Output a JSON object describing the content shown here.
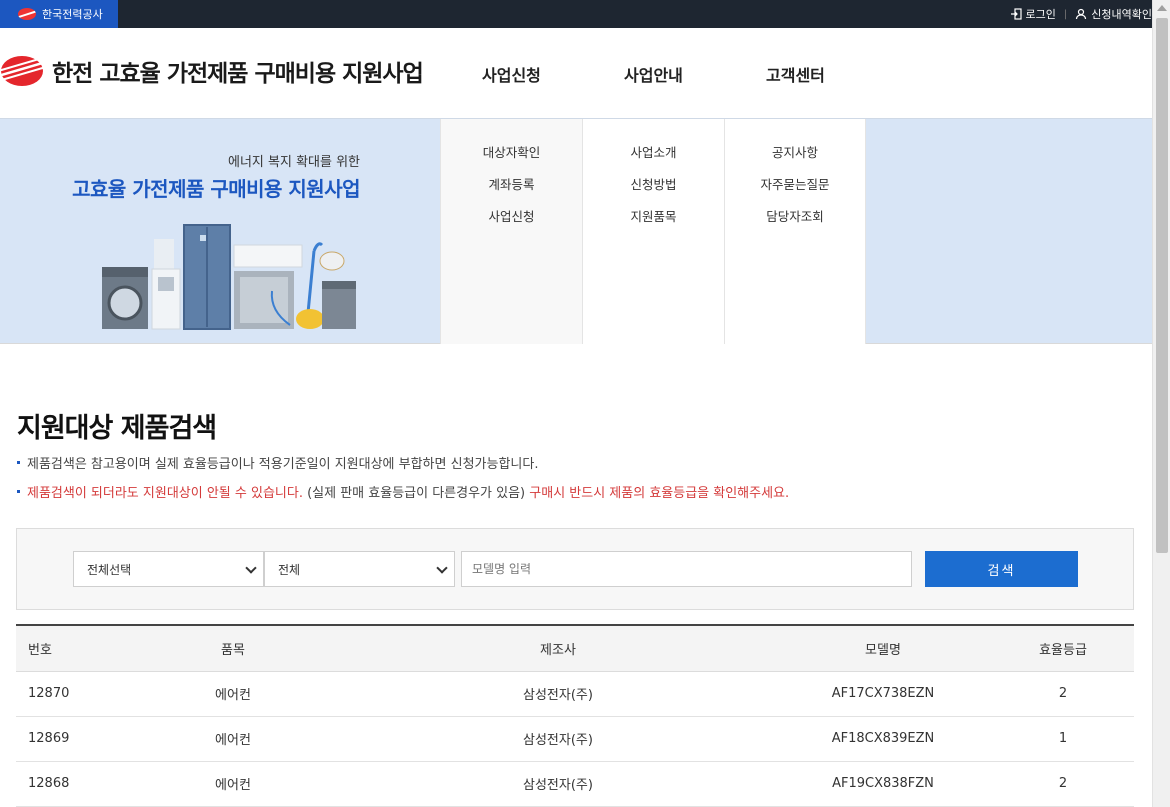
{
  "topbar": {
    "org_name": "한국전력공사",
    "login_label": "로그인",
    "check_label": "신청내역확인"
  },
  "header": {
    "title": "한전 고효율 가전제품 구매비용 지원사업",
    "nav": [
      {
        "label": "사업신청"
      },
      {
        "label": "사업안내"
      },
      {
        "label": "고객센터"
      }
    ]
  },
  "mega": {
    "promo_sub": "에너지 복지 확대를 위한",
    "promo_title": "고효율 가전제품 구매비용 지원사업",
    "columns": [
      {
        "items": [
          "대상자확인",
          "계좌등록",
          "사업신청"
        ]
      },
      {
        "items": [
          "사업소개",
          "신청방법",
          "지원품목"
        ]
      },
      {
        "items": [
          "공지사항",
          "자주묻는질문",
          "담당자조회"
        ]
      }
    ]
  },
  "content": {
    "title": "지원대상 제품검색",
    "notice1": "제품검색은 참고용이며 실제 효율등급이나 적용기준일이 지원대상에 부합하면 신청가능합니다.",
    "notice2_red1": "제품검색이 되더라도 지원대상이 안될 수 있습니다.",
    "notice2_mid": " (실제 판매 효율등급이 다른경우가 있음) ",
    "notice2_red2": "구매시 반드시 제품의 효율등급을 확인해주세요."
  },
  "search": {
    "category_selected": "전체선택",
    "subcategory_selected": "전체",
    "model_placeholder": "모델명 입력",
    "button_label": "검색"
  },
  "table": {
    "headers": [
      "번호",
      "품목",
      "제조사",
      "모델명",
      "효율등급"
    ],
    "rows": [
      [
        "12870",
        "에어컨",
        "삼성전자(주)",
        "AF17CX738EZN",
        "2"
      ],
      [
        "12869",
        "에어컨",
        "삼성전자(주)",
        "AF18CX839EZN",
        "1"
      ],
      [
        "12868",
        "에어컨",
        "삼성전자(주)",
        "AF19CX838FZN",
        "2"
      ]
    ]
  },
  "colors": {
    "brand_blue": "#1c57c0",
    "button_blue": "#1c6dd0",
    "notice_red": "#d43a3a",
    "topbar_dark": "#1e2631"
  }
}
